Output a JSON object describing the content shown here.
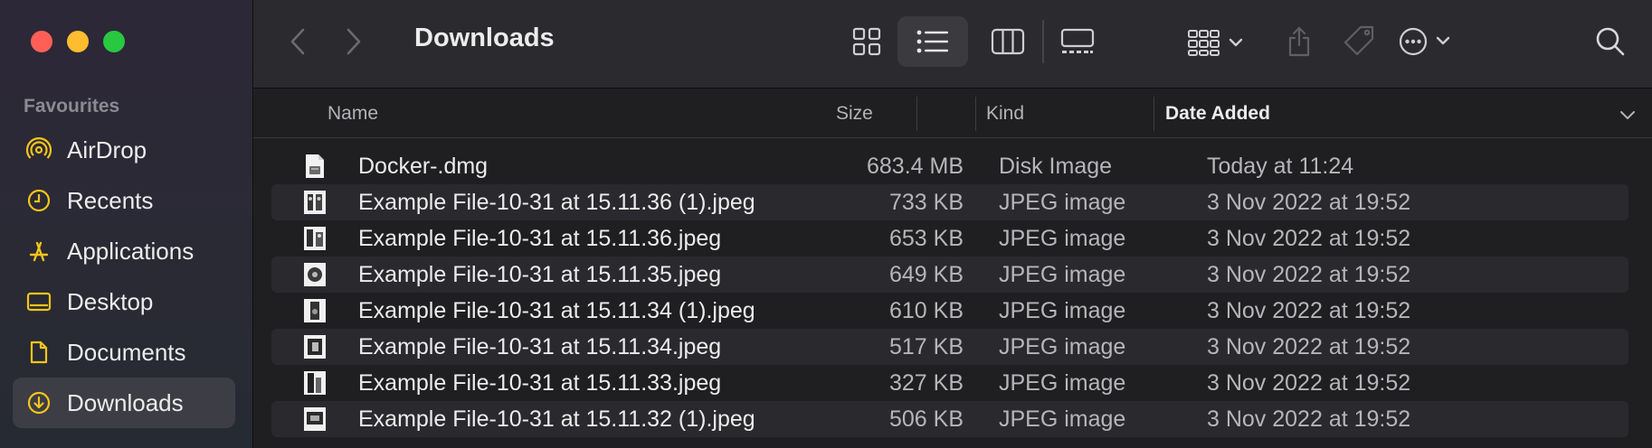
{
  "window": {
    "title": "Downloads"
  },
  "sidebar": {
    "heading": "Favourites",
    "items": [
      {
        "label": "AirDrop",
        "icon": "airdrop-icon"
      },
      {
        "label": "Recents",
        "icon": "clock-icon"
      },
      {
        "label": "Applications",
        "icon": "applications-icon"
      },
      {
        "label": "Desktop",
        "icon": "desktop-icon"
      },
      {
        "label": "Documents",
        "icon": "document-icon"
      },
      {
        "label": "Downloads",
        "icon": "download-icon",
        "active": true
      }
    ]
  },
  "columns": {
    "name": "Name",
    "size": "Size",
    "kind": "Kind",
    "date": "Date Added"
  },
  "files": [
    {
      "name": "Docker-.dmg",
      "size": "683.4 MB",
      "kind": "Disk Image",
      "date": "Today at 11:24",
      "icon": "disk-image-icon"
    },
    {
      "name": "Example File-10-31 at 15.11.36 (1).jpeg",
      "size": "733 KB",
      "kind": "JPEG image",
      "date": "3 Nov 2022 at 19:52",
      "icon": "jpeg-thumbnail-icon"
    },
    {
      "name": "Example File-10-31 at 15.11.36.jpeg",
      "size": "653 KB",
      "kind": "JPEG image",
      "date": "3 Nov 2022 at 19:52",
      "icon": "jpeg-thumbnail-icon"
    },
    {
      "name": "Example File-10-31 at 15.11.35.jpeg",
      "size": "649 KB",
      "kind": "JPEG image",
      "date": "3 Nov 2022 at 19:52",
      "icon": "jpeg-thumbnail-icon"
    },
    {
      "name": "Example File-10-31 at 15.11.34 (1).jpeg",
      "size": "610 KB",
      "kind": "JPEG image",
      "date": "3 Nov 2022 at 19:52",
      "icon": "jpeg-thumbnail-icon"
    },
    {
      "name": "Example File-10-31 at 15.11.34.jpeg",
      "size": "517 KB",
      "kind": "JPEG image",
      "date": "3 Nov 2022 at 19:52",
      "icon": "jpeg-thumbnail-icon"
    },
    {
      "name": "Example File-10-31 at 15.11.33.jpeg",
      "size": "327 KB",
      "kind": "JPEG image",
      "date": "3 Nov 2022 at 19:52",
      "icon": "jpeg-thumbnail-icon"
    },
    {
      "name": "Example File-10-31 at 15.11.32 (1).jpeg",
      "size": "506 KB",
      "kind": "JPEG image",
      "date": "3 Nov 2022 at 19:52",
      "icon": "jpeg-thumbnail-icon"
    }
  ],
  "colors": {
    "accent": "#f5c518",
    "close": "#ff5f57",
    "minimize": "#febc2e",
    "zoom": "#28c840"
  }
}
